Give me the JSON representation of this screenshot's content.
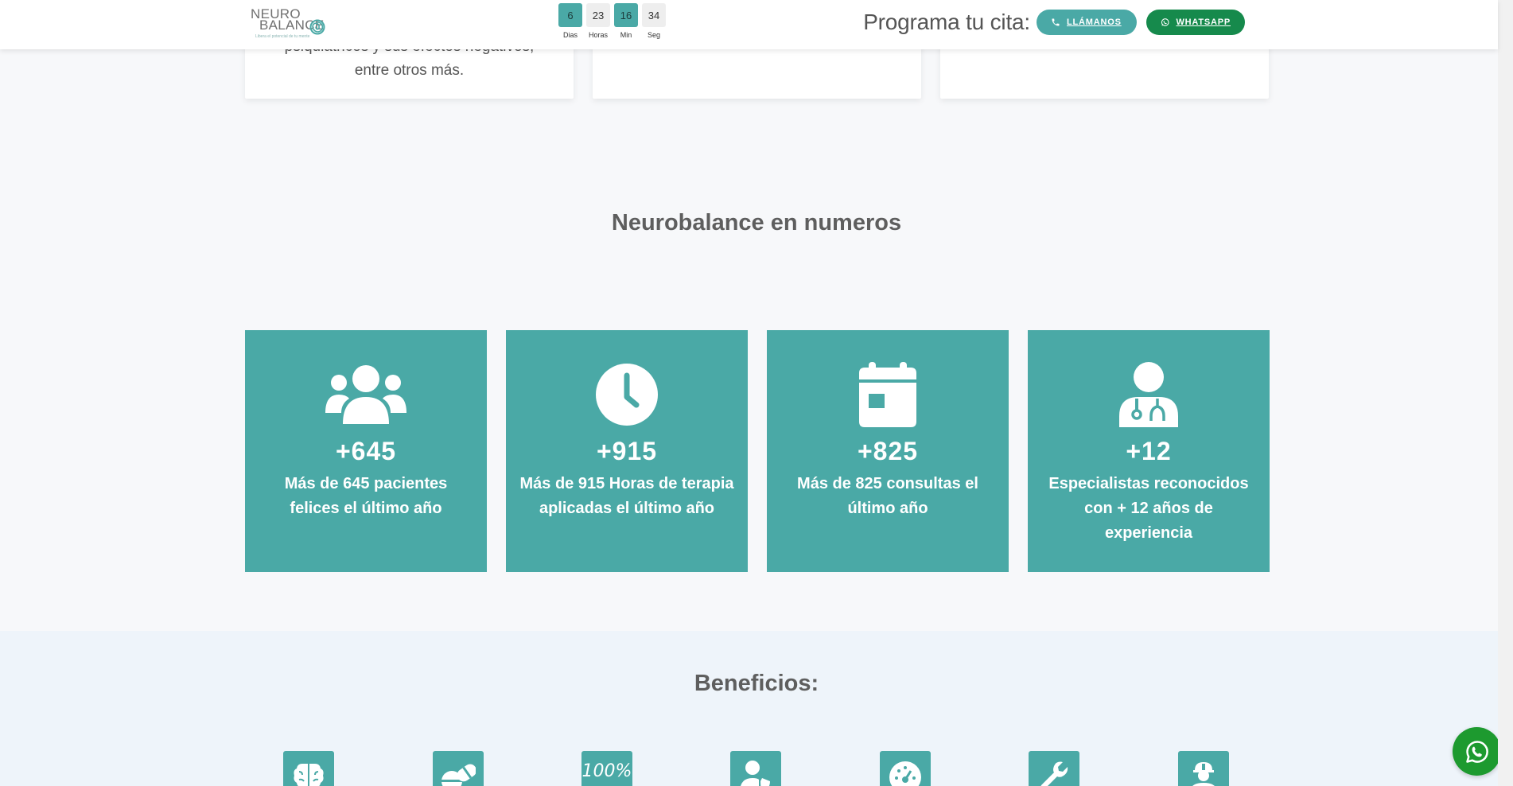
{
  "header": {
    "logo": {
      "line1": "NEURO",
      "line2": "BALANCE",
      "tagline": "Libera el potencial de tu mente"
    },
    "countdown": [
      {
        "value": "6",
        "label": "Dias"
      },
      {
        "value": "23",
        "label": "Horas"
      },
      {
        "value": "16",
        "label": "Min"
      },
      {
        "value": "34",
        "label": "Seg"
      }
    ],
    "cta_text": "Programa tu cita:",
    "call_label": "LLÁMANOS",
    "whatsapp_label": "WHATSAPP"
  },
  "top_cards": {
    "card1_line1": "psiquiátricos y sus efectos negativos,",
    "card1_line2": "entre otros más."
  },
  "stats": {
    "title": "Neurobalance en numeros",
    "items": [
      {
        "icon": "users-icon",
        "number": "+645",
        "description": "Más de 645 pacientes felices el último año"
      },
      {
        "icon": "clock-icon",
        "number": "+915",
        "description": "Más de 915 Horas de terapia aplicadas el último año"
      },
      {
        "icon": "calendar-icon",
        "number": "+825",
        "description": "Más de 825 consultas el último año"
      },
      {
        "icon": "doctor-icon",
        "number": "+12",
        "description": "Especialistas reconocidos con + 12 años de experiencia"
      }
    ]
  },
  "benefits": {
    "title": "Beneficios:",
    "icons": [
      "brain-icon",
      "pills-icon",
      "hundred-percent-icon",
      "user-shield-icon",
      "gauge-icon",
      "wrench-icon",
      "worker-icon"
    ],
    "hundred_text": "100%"
  },
  "colors": {
    "teal": "#4aa9a6",
    "whatsapp_green": "#168a4c",
    "float_green": "#1d9a2f"
  }
}
